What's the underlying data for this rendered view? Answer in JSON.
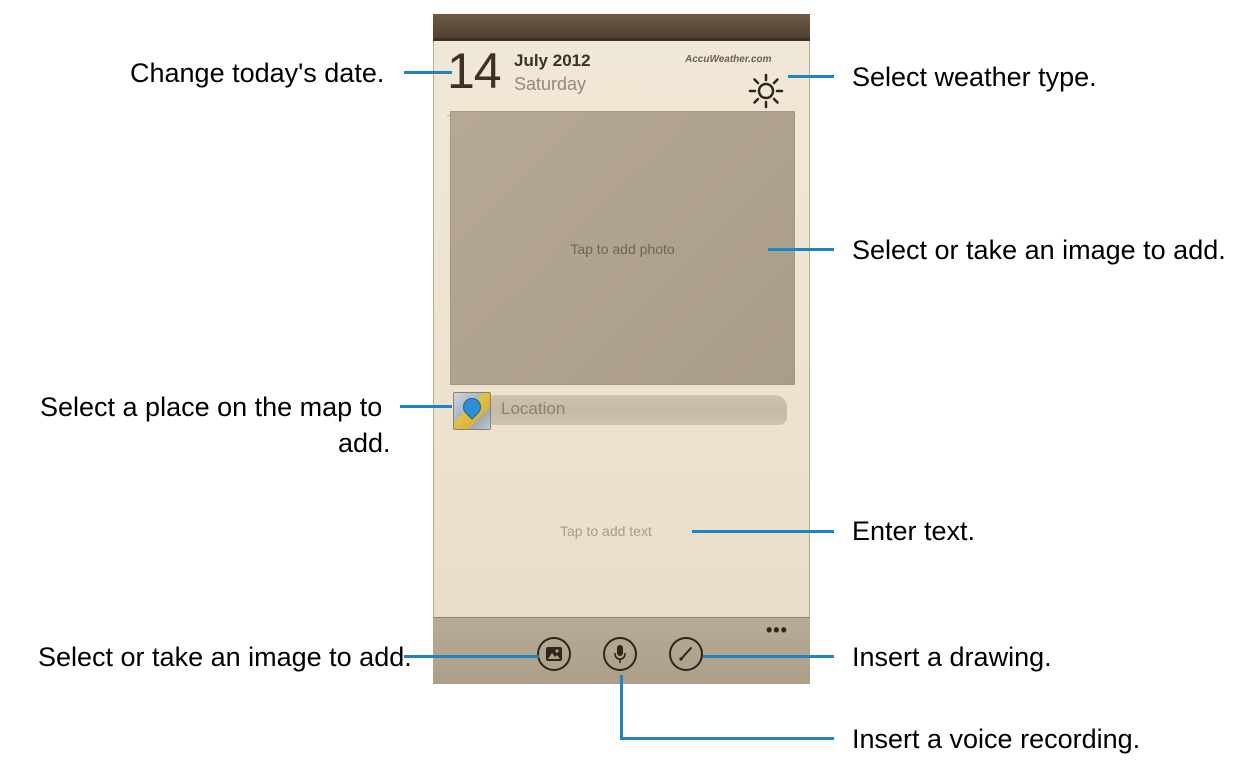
{
  "phone": {
    "date_day": "14",
    "date_month_year": "July 2012",
    "date_weekday": "Saturday",
    "weather_provider": "AccuWeather.com",
    "photo_placeholder": "Tap to add photo",
    "location_placeholder": "Location",
    "text_placeholder": "Tap to add text",
    "more_options": "•••"
  },
  "icons": {
    "weather": "sun-icon",
    "location": "map-pin-icon",
    "image": "image-icon",
    "voice": "microphone-icon",
    "drawing": "pen-icon",
    "more": "more-options-icon"
  },
  "callouts": {
    "change_date": "Change today's date.",
    "select_weather": "Select weather type.",
    "select_image_top": "Select or take an image to add.",
    "select_place_line1": "Select a place on the map to",
    "select_place_line2": "add.",
    "enter_text": "Enter text.",
    "select_image_bottom": "Select or take an image to add.",
    "insert_drawing": "Insert a drawing.",
    "insert_voice": "Insert a voice recording."
  },
  "colors": {
    "callout_line": "#1f83c4",
    "page_background": "#ece2ce",
    "toolbar": "#b0a38d"
  }
}
